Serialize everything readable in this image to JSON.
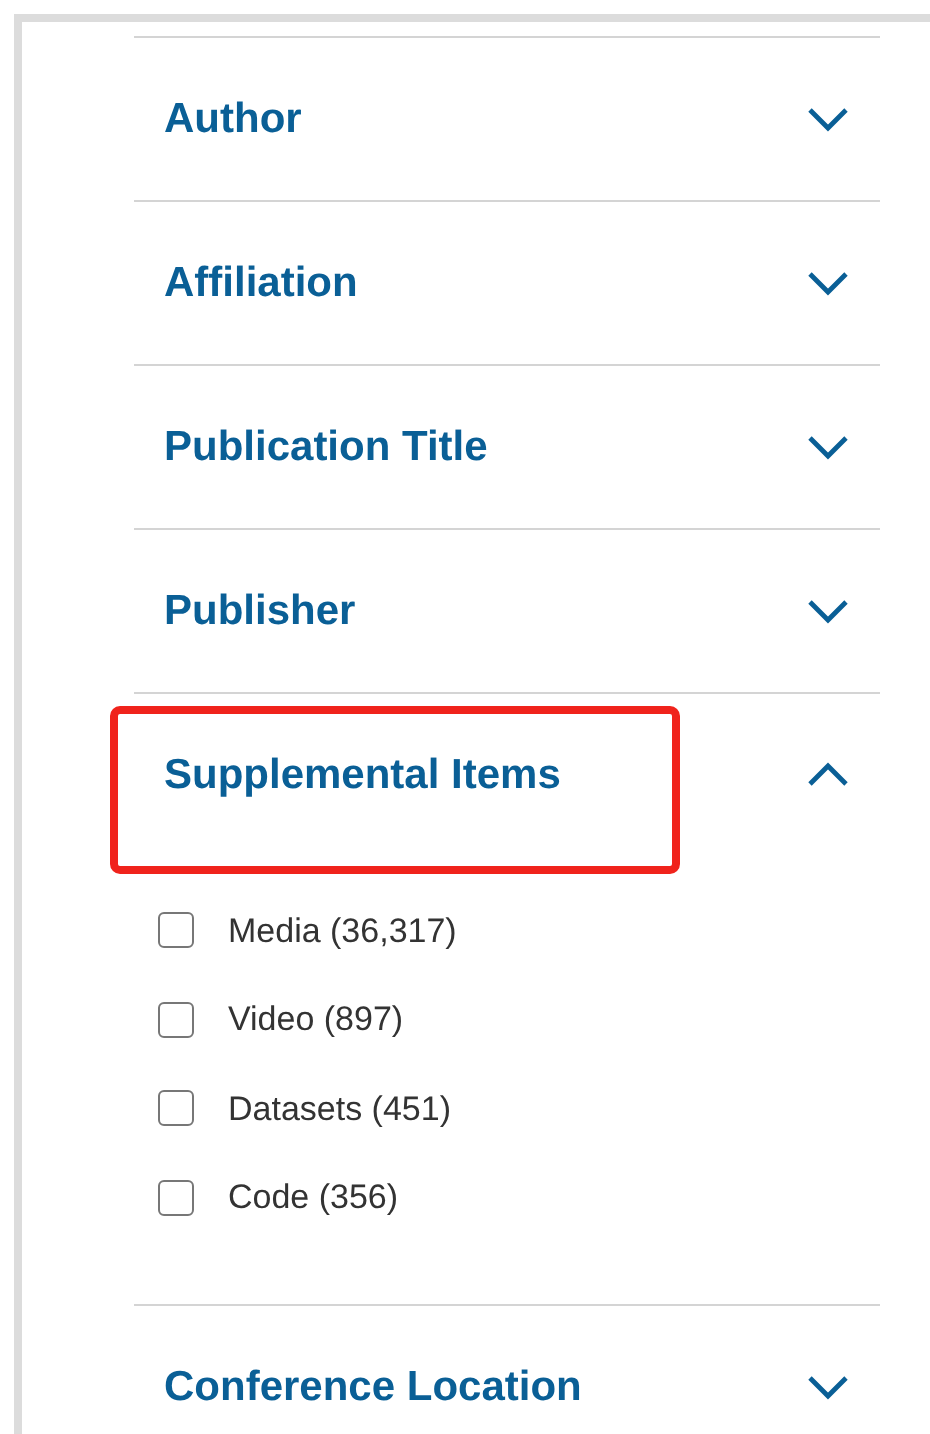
{
  "filters": [
    {
      "title": "Author",
      "expanded": false,
      "highlighted": false
    },
    {
      "title": "Affiliation",
      "expanded": false,
      "highlighted": false
    },
    {
      "title": "Publication Title",
      "expanded": false,
      "highlighted": false
    },
    {
      "title": "Publisher",
      "expanded": false,
      "highlighted": false
    },
    {
      "title": "Supplemental Items",
      "expanded": true,
      "highlighted": true,
      "options": [
        {
          "label": "Media (36,317)",
          "checked": false
        },
        {
          "label": "Video (897)",
          "checked": false
        },
        {
          "label": "Datasets (451)",
          "checked": false
        },
        {
          "label": "Code (356)",
          "checked": false
        }
      ]
    },
    {
      "title": "Conference Location",
      "expanded": false,
      "highlighted": false
    }
  ]
}
